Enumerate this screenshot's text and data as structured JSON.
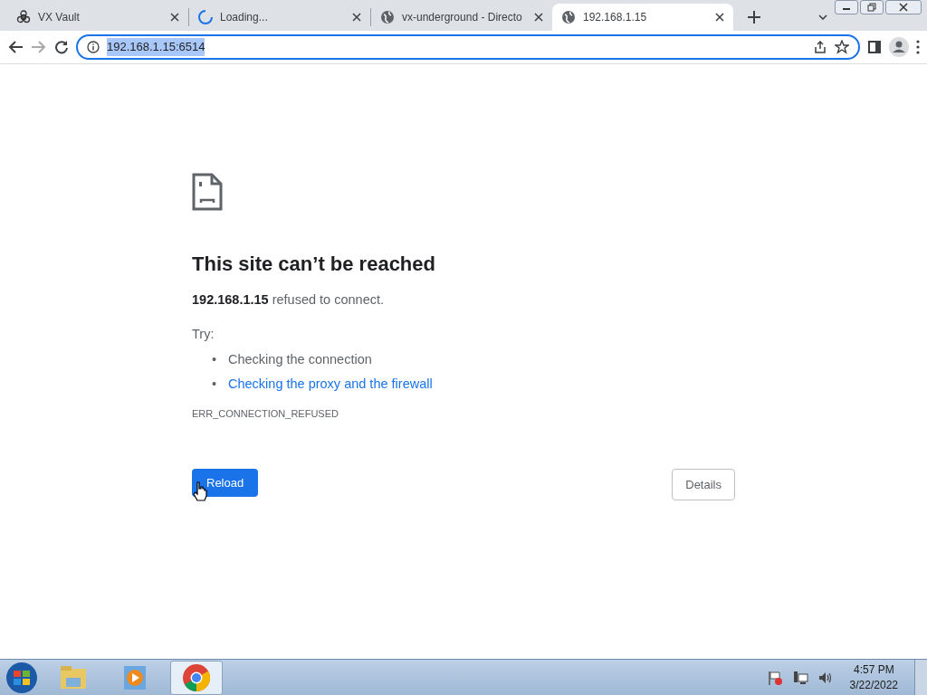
{
  "tabs": [
    {
      "title": "VX Vault",
      "kind": "biohazard",
      "selected": false
    },
    {
      "title": "Loading...",
      "kind": "loading",
      "selected": false
    },
    {
      "title": "vx-underground - Directo",
      "kind": "site",
      "selected": false
    },
    {
      "title": "192.168.1.15",
      "kind": "site",
      "selected": true
    }
  ],
  "address_bar": {
    "url": "192.168.1.15:6514",
    "selected": true
  },
  "error_page": {
    "heading": "This site can’t be reached",
    "message": "**192.168.1.15** refused to connect.",
    "try_label": "Try:",
    "suggestions": [
      {
        "marker": "•",
        "text": "Checking the connection",
        "kind": "text"
      },
      {
        "marker": "•",
        "text": "Checking the proxy and the firewall",
        "kind": "link"
      }
    ],
    "error_code": "ERR_CONNECTION_REFUSED",
    "reload_button": "Reload",
    "details_button": "Details"
  },
  "taskbar": {
    "apps": [
      {
        "kind": "folder",
        "selected": false
      },
      {
        "kind": "player",
        "selected": false
      },
      {
        "kind": "browser",
        "selected": true
      }
    ],
    "time": "4:57 PM",
    "date": "3/22/2022"
  }
}
